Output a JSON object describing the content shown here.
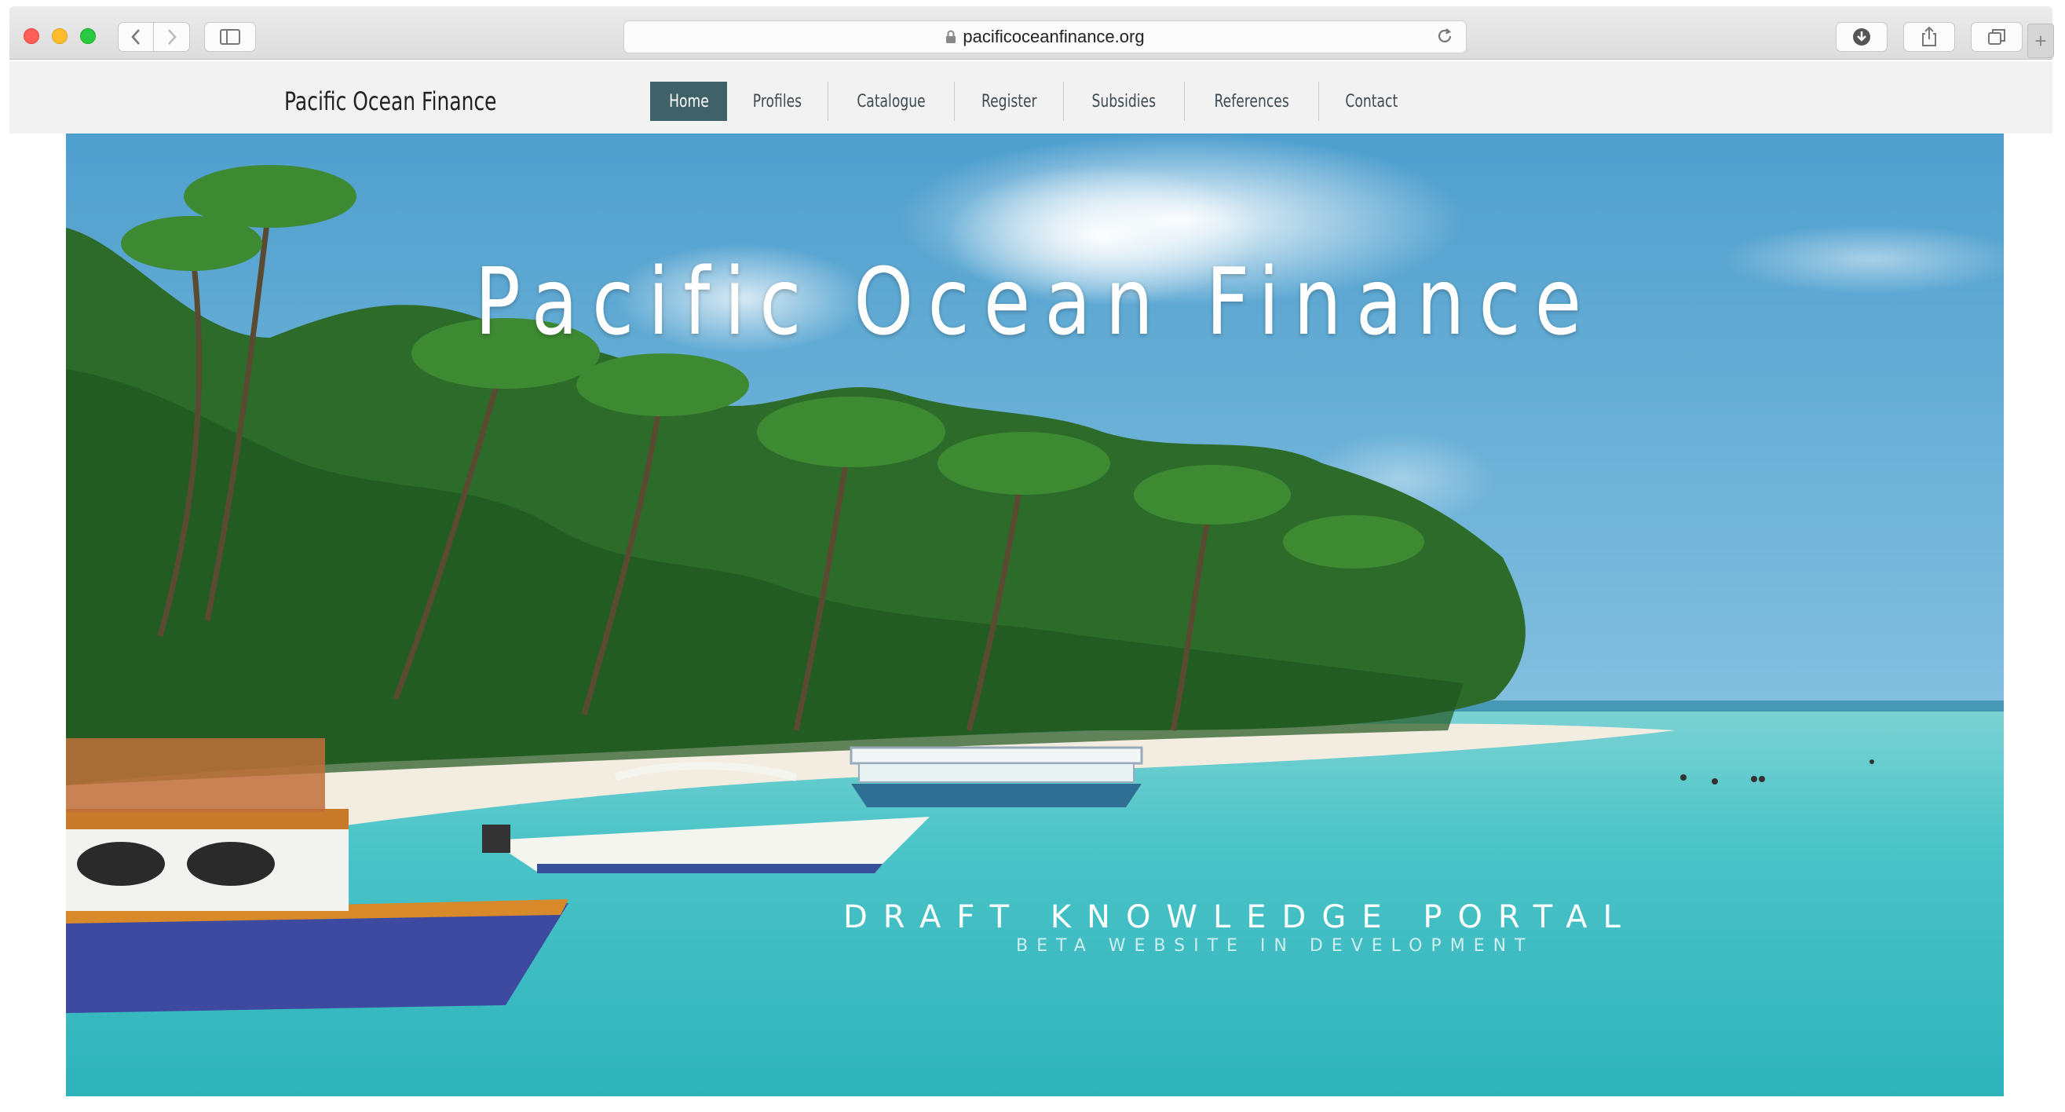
{
  "browser": {
    "url": "pacificoceanfinance.org",
    "back_icon": "‹",
    "forward_icon": "›",
    "new_tab_icon": "+"
  },
  "header": {
    "brand": "Pacific Ocean Finance",
    "nav": [
      {
        "label": "Home",
        "active": true
      },
      {
        "label": "Profiles"
      },
      {
        "label": "Catalogue"
      },
      {
        "label": "Register"
      },
      {
        "label": "Subsidies"
      },
      {
        "label": "References"
      },
      {
        "label": "Contact"
      }
    ]
  },
  "hero": {
    "title": "Pacific Ocean Finance",
    "subtitle": "DRAFT KNOWLEDGE PORTAL",
    "tagline": "BETA WEBSITE IN DEVELOPMENT"
  },
  "colors": {
    "nav_active": "#3f6168",
    "sky": "#6fb2d6",
    "sea": "#43c0c6",
    "sand": "#f3ece0",
    "palm": "#2e6a2a"
  }
}
